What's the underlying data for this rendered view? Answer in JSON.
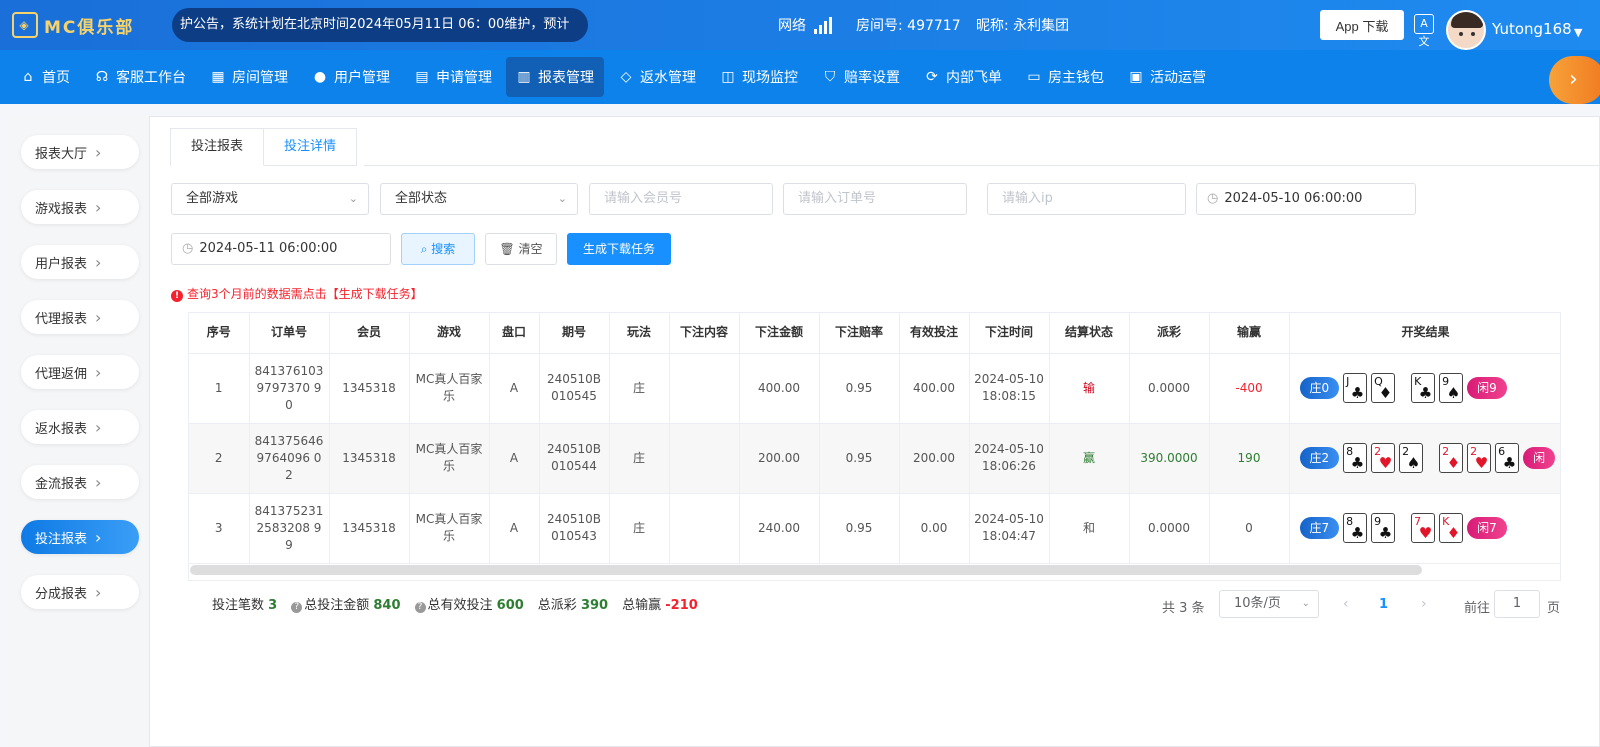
{
  "header": {
    "logo_text": "MC俱乐部",
    "notice": "护公告，系统计划在北京时间2024年05月11日 06：00维护，预计",
    "network_label": "网络",
    "room_label": "房间号: 497717",
    "nickname": "昵称: 永利集团",
    "app_download": "App 下载",
    "translate_icon": "A文",
    "username": "Yutong168"
  },
  "nav": {
    "items": [
      {
        "label": "首页",
        "icon": "home-icon"
      },
      {
        "label": "客服工作台",
        "icon": "headset-icon"
      },
      {
        "label": "房间管理",
        "icon": "grid-icon"
      },
      {
        "label": "用户管理",
        "icon": "user-icon"
      },
      {
        "label": "申请管理",
        "icon": "document-icon"
      },
      {
        "label": "报表管理",
        "icon": "bar-chart-icon"
      },
      {
        "label": "返水管理",
        "icon": "tag-icon"
      },
      {
        "label": "现场监控",
        "icon": "monitor-icon"
      },
      {
        "label": "赔率设置",
        "icon": "shield-icon"
      },
      {
        "label": "内部飞单",
        "icon": "refresh-icon"
      },
      {
        "label": "房主钱包",
        "icon": "wallet-icon"
      },
      {
        "label": "活动运营",
        "icon": "calendar-icon"
      }
    ],
    "active_index": 5,
    "next_arrow": "›"
  },
  "sidebar": {
    "items": [
      {
        "label": "报表大厅"
      },
      {
        "label": "游戏报表"
      },
      {
        "label": "用户报表"
      },
      {
        "label": "代理报表"
      },
      {
        "label": "代理返佣"
      },
      {
        "label": "返水报表"
      },
      {
        "label": "金流报表"
      },
      {
        "label": "投注报表"
      },
      {
        "label": "分成报表"
      }
    ],
    "active_index": 7
  },
  "tabs": [
    {
      "label": "投注报表"
    },
    {
      "label": "投注详情"
    }
  ],
  "filters": {
    "game_select": "全部游戏",
    "status_select": "全部状态",
    "member_placeholder": "请输入会员号",
    "order_placeholder": "请输入订单号",
    "ip_placeholder": "请输入ip",
    "start_time": "2024-05-10 06:00:00",
    "end_time": "2024-05-11 06:00:00",
    "search_label": "搜索",
    "clear_label": "清空",
    "generate_label": "生成下载任务"
  },
  "warning": "查询3个月前的数据需点击【生成下载任务】",
  "table": {
    "headers": [
      "序号",
      "订单号",
      "会员",
      "游戏",
      "盘口",
      "期号",
      "玩法",
      "下注内容",
      "下注金额",
      "下注赔率",
      "有效投注",
      "下注时间",
      "结算状态",
      "派彩",
      "输赢",
      "开奖结果"
    ],
    "rows": [
      {
        "no": "1",
        "order": "8413761039797370 90",
        "member": "1345318",
        "game": "MC真人百家乐",
        "market": "A",
        "period": "240510B010545",
        "play": "庄",
        "content": "",
        "amount": "400.00",
        "odds": "0.95",
        "valid": "400.00",
        "time": "2024-05-10 18:08:15",
        "status": "输",
        "payout": "0.0000",
        "winloss": "-400",
        "banker": "庄0",
        "player": "闲9",
        "banker_cards": [
          {
            "rank": "J",
            "suit": "♣",
            "color": "black"
          },
          {
            "rank": "Q",
            "suit": "♦",
            "color": "black"
          }
        ],
        "player_cards": [
          {
            "rank": "K",
            "suit": "♣",
            "color": "black"
          },
          {
            "rank": "9",
            "suit": "♠",
            "color": "black"
          }
        ]
      },
      {
        "no": "2",
        "order": "8413756469764096 02",
        "member": "1345318",
        "game": "MC真人百家乐",
        "market": "A",
        "period": "240510B010544",
        "play": "庄",
        "content": "",
        "amount": "200.00",
        "odds": "0.95",
        "valid": "200.00",
        "time": "2024-05-10 18:06:26",
        "status": "赢",
        "payout": "390.0000",
        "winloss": "190",
        "banker": "庄2",
        "player": "闲",
        "banker_cards": [
          {
            "rank": "8",
            "suit": "♣",
            "color": "black"
          },
          {
            "rank": "2",
            "suit": "♥",
            "color": "red"
          },
          {
            "rank": "2",
            "suit": "♠",
            "color": "black"
          }
        ],
        "player_cards": [
          {
            "rank": "2",
            "suit": "♦",
            "color": "red"
          },
          {
            "rank": "2",
            "suit": "♥",
            "color": "red"
          },
          {
            "rank": "6",
            "suit": "♣",
            "color": "black"
          }
        ]
      },
      {
        "no": "3",
        "order": "8413752312583208 99",
        "member": "1345318",
        "game": "MC真人百家乐",
        "market": "A",
        "period": "240510B010543",
        "play": "庄",
        "content": "",
        "amount": "240.00",
        "odds": "0.95",
        "valid": "0.00",
        "time": "2024-05-10 18:04:47",
        "status": "和",
        "payout": "0.0000",
        "winloss": "0",
        "banker": "庄7",
        "player": "闲7",
        "banker_cards": [
          {
            "rank": "8",
            "suit": "♣",
            "color": "black"
          },
          {
            "rank": "9",
            "suit": "♣",
            "color": "black"
          }
        ],
        "player_cards": [
          {
            "rank": "7",
            "suit": "♥",
            "color": "red"
          },
          {
            "rank": "K",
            "suit": "♦",
            "color": "red"
          }
        ]
      }
    ]
  },
  "summary": {
    "count_label": "投注笔数",
    "count": "3",
    "total_bet_label": "总投注金额",
    "total_bet": "840",
    "total_valid_label": "总有效投注",
    "total_valid": "600",
    "total_payout_label": "总派彩",
    "total_payout": "390",
    "total_winloss_label": "总输赢",
    "total_winloss": "-210"
  },
  "pagination": {
    "total": "共 3 条",
    "page_size": "10条/页",
    "current_page": "1",
    "goto_label": "前往",
    "goto_value": "1",
    "page_suffix": "页"
  },
  "colors": {
    "nav_bg": "#0c82ea",
    "accent": "#1890ff",
    "win": "#2e7d32",
    "lose": "#d0021b",
    "banker_pill": "#1563c8",
    "player_pill": "#d81b76"
  }
}
